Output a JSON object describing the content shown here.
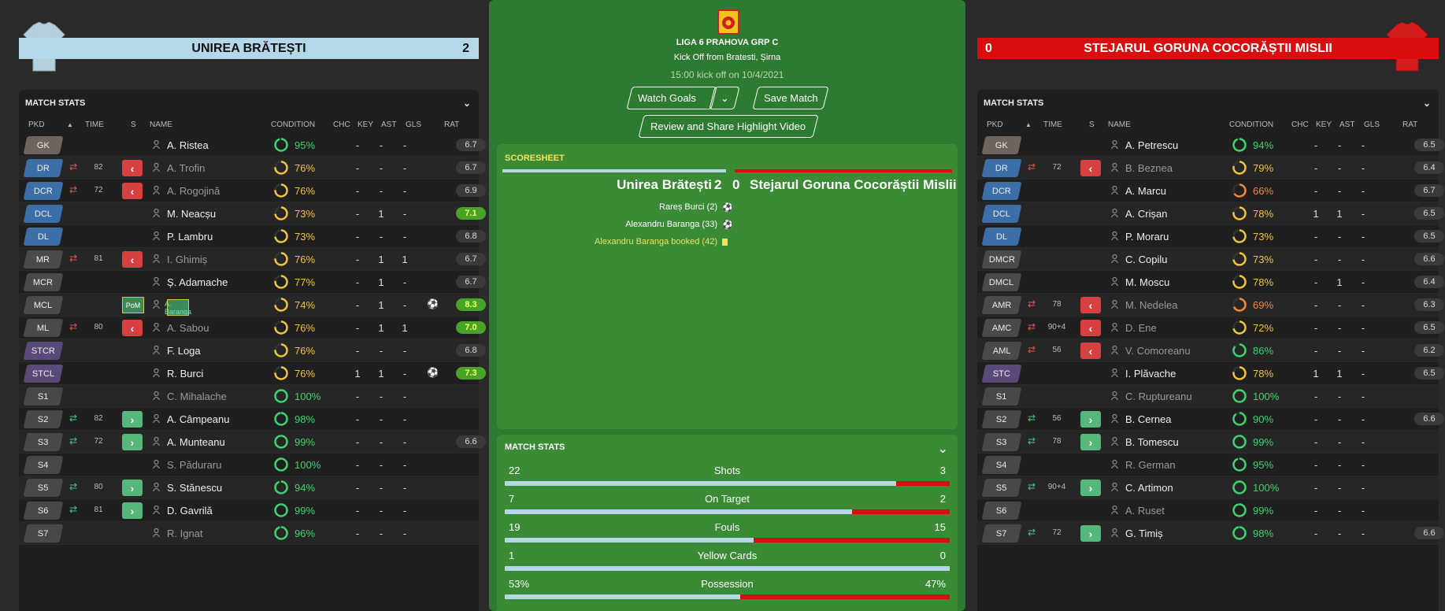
{
  "home": {
    "name": "UNIREA BRĂTEȘTI",
    "score": "2",
    "shirt_color": "#b5d0dc",
    "bar_color": "#b5d8e8"
  },
  "away": {
    "name": "STEJARUL GORUNA COCORĂȘTII MISLII",
    "score": "0",
    "shirt_color": "#d61d1d",
    "bar_color": "#d90f0f"
  },
  "center": {
    "league": "LIGA 6 PRAHOVA GRP C",
    "venue": "Kick Off from Bratesti, Șirna",
    "kickoff": "15:00 kick off on 10/4/2021",
    "watch_goals": "Watch Goals",
    "save_match": "Save Match",
    "review": "Review and Share Highlight Video",
    "scoresheet_title": "SCORESHEET",
    "sheet_home": "Unirea Brătești",
    "sheet_home_score": "2",
    "sheet_away_score": "0",
    "sheet_away": "Stejarul Goruna Cocorăștii Mislii",
    "events": [
      {
        "text": "Rareș Burci (2)",
        "icon": "ball-icon",
        "color": "#ffffff"
      },
      {
        "text": "Alexandru Baranga (33)",
        "icon": "ball-icon",
        "color": "#ffffff"
      },
      {
        "text": "Alexandru Baranga booked (42)",
        "icon": "yellow-card-icon",
        "color": "#f3e35a"
      }
    ],
    "match_stats_title": "MATCH STATS",
    "stats": [
      {
        "label": "Shots",
        "home": "22",
        "away": "3",
        "home_share": 0.88
      },
      {
        "label": "On Target",
        "home": "7",
        "away": "2",
        "home_share": 0.78
      },
      {
        "label": "Fouls",
        "home": "19",
        "away": "15",
        "home_share": 0.56
      },
      {
        "label": "Yellow Cards",
        "home": "1",
        "away": "0",
        "home_share": 1.0
      },
      {
        "label": "Possession",
        "home": "53%",
        "away": "47%",
        "home_share": 0.53
      }
    ]
  },
  "table_headers": {
    "title": "MATCH STATS",
    "pkd": "PKD",
    "time": "TIME",
    "s": "S",
    "name": "NAME",
    "condition": "CONDITION",
    "chc": "CHC",
    "key": "KEY",
    "ast": "AST",
    "gls": "GLS",
    "rat": "RAT",
    "sort_icon": "sort-up-icon"
  },
  "colors": {
    "gk": "#6e665e",
    "def": "#3c6fa8",
    "mid": "#4a4a4a",
    "att": "#5a4a7a",
    "sub": "#484848",
    "cond_green": "#3dd470",
    "cond_yellow": "#f2c43a",
    "cond_orange": "#f08a3a"
  },
  "home_players": [
    {
      "pos": "GK",
      "cat": "gk",
      "name": "A. Ristea",
      "cond": "95%",
      "cond_val": 0.95,
      "ccol": "cond_green",
      "chc": "-",
      "key": "-",
      "ast": "-",
      "gls": "",
      "rat": "6.7",
      "rat_green": false,
      "dim": false
    },
    {
      "pos": "DR",
      "cat": "def",
      "sub": "off",
      "time": "82",
      "name": "A. Trofin",
      "cond": "76%",
      "cond_val": 0.76,
      "ccol": "cond_yellow",
      "chc": "-",
      "key": "-",
      "ast": "-",
      "gls": "",
      "rat": "6.7",
      "dim": true
    },
    {
      "pos": "DCR",
      "cat": "def",
      "sub": "off",
      "time": "72",
      "name": "A. Rogojină",
      "cond": "76%",
      "cond_val": 0.76,
      "ccol": "cond_yellow",
      "chc": "-",
      "key": "-",
      "ast": "-",
      "gls": "",
      "rat": "6.9",
      "dim": true
    },
    {
      "pos": "DCL",
      "cat": "def",
      "name": "M. Neacșu",
      "cond": "73%",
      "cond_val": 0.73,
      "ccol": "cond_yellow",
      "chc": "-",
      "key": "1",
      "ast": "-",
      "gls": "",
      "rat": "7.1",
      "rat_green": true
    },
    {
      "pos": "DL",
      "cat": "def",
      "name": "P. Lambru",
      "cond": "73%",
      "cond_val": 0.73,
      "ccol": "cond_yellow",
      "chc": "-",
      "key": "-",
      "ast": "-",
      "gls": "",
      "rat": "6.8"
    },
    {
      "pos": "MR",
      "cat": "mid",
      "sub": "off",
      "time": "81",
      "name": "I. Ghimiș",
      "cond": "76%",
      "cond_val": 0.76,
      "ccol": "cond_yellow",
      "chc": "-",
      "key": "1",
      "ast": "1",
      "gls": "",
      "rat": "6.7",
      "dim": true
    },
    {
      "pos": "MCR",
      "cat": "mid",
      "name": "Ș. Adamache",
      "cond": "77%",
      "cond_val": 0.77,
      "ccol": "cond_yellow",
      "chc": "-",
      "key": "1",
      "ast": "-",
      "gls": "",
      "rat": "6.7"
    },
    {
      "pos": "MCL",
      "cat": "mid",
      "pom": "PoM",
      "name": "A. Baranga",
      "cond": "74%",
      "cond_val": 0.74,
      "ccol": "cond_yellow",
      "chc": "-",
      "key": "1",
      "ast": "-",
      "gls": "ball",
      "rat": "8.3",
      "rat_green": true,
      "highlight": true
    },
    {
      "pos": "ML",
      "cat": "mid",
      "sub": "off",
      "time": "80",
      "name": "A. Sabou",
      "cond": "76%",
      "cond_val": 0.76,
      "ccol": "cond_yellow",
      "chc": "-",
      "key": "1",
      "ast": "1",
      "gls": "",
      "rat": "7.0",
      "rat_green": true,
      "dim": true
    },
    {
      "pos": "STCR",
      "cat": "att",
      "name": "F. Loga",
      "cond": "76%",
      "cond_val": 0.76,
      "ccol": "cond_yellow",
      "chc": "-",
      "key": "-",
      "ast": "-",
      "gls": "",
      "rat": "6.8"
    },
    {
      "pos": "STCL",
      "cat": "att",
      "name": "R. Burci",
      "cond": "76%",
      "cond_val": 0.76,
      "ccol": "cond_yellow",
      "chc": "1",
      "key": "1",
      "ast": "-",
      "gls": "ball",
      "rat": "7.3",
      "rat_green": true
    },
    {
      "pos": "S1",
      "cat": "sub",
      "name": "C. Mihalache",
      "cond": "100%",
      "cond_val": 1.0,
      "ccol": "cond_green",
      "chc": "-",
      "key": "-",
      "ast": "-",
      "gls": "",
      "rat": "",
      "dim": true
    },
    {
      "pos": "S2",
      "cat": "sub",
      "sub": "on",
      "time": "82",
      "name": "A. Câmpeanu",
      "cond": "98%",
      "cond_val": 0.98,
      "ccol": "cond_green",
      "chc": "-",
      "key": "-",
      "ast": "-",
      "gls": "",
      "rat": ""
    },
    {
      "pos": "S3",
      "cat": "sub",
      "sub": "on",
      "time": "72",
      "name": "A. Munteanu",
      "cond": "99%",
      "cond_val": 0.99,
      "ccol": "cond_green",
      "chc": "-",
      "key": "-",
      "ast": "-",
      "gls": "",
      "rat": "6.6"
    },
    {
      "pos": "S4",
      "cat": "sub",
      "name": "S. Păduraru",
      "cond": "100%",
      "cond_val": 1.0,
      "ccol": "cond_green",
      "chc": "-",
      "key": "-",
      "ast": "-",
      "gls": "",
      "rat": "",
      "dim": true
    },
    {
      "pos": "S5",
      "cat": "sub",
      "sub": "on",
      "time": "80",
      "name": "S. Stănescu",
      "cond": "94%",
      "cond_val": 0.94,
      "ccol": "cond_green",
      "chc": "-",
      "key": "-",
      "ast": "-",
      "gls": "",
      "rat": ""
    },
    {
      "pos": "S6",
      "cat": "sub",
      "sub": "on",
      "time": "81",
      "name": "D. Gavrilă",
      "cond": "99%",
      "cond_val": 0.99,
      "ccol": "cond_green",
      "chc": "-",
      "key": "-",
      "ast": "-",
      "gls": "",
      "rat": ""
    },
    {
      "pos": "S7",
      "cat": "sub",
      "name": "R. Ignat",
      "cond": "96%",
      "cond_val": 0.96,
      "ccol": "cond_green",
      "chc": "-",
      "key": "-",
      "ast": "-",
      "gls": "",
      "rat": "",
      "dim": true
    }
  ],
  "away_players": [
    {
      "pos": "GK",
      "cat": "gk",
      "name": "A. Petrescu",
      "cond": "94%",
      "cond_val": 0.94,
      "ccol": "cond_green",
      "chc": "-",
      "key": "-",
      "ast": "-",
      "gls": "",
      "rat": "6.5"
    },
    {
      "pos": "DR",
      "cat": "def",
      "sub": "off",
      "time": "72",
      "name": "B. Beznea",
      "cond": "79%",
      "cond_val": 0.79,
      "ccol": "cond_yellow",
      "chc": "-",
      "key": "-",
      "ast": "-",
      "gls": "",
      "rat": "6.4",
      "dim": true
    },
    {
      "pos": "DCR",
      "cat": "def",
      "name": "A. Marcu",
      "cond": "66%",
      "cond_val": 0.66,
      "ccol": "cond_orange",
      "chc": "-",
      "key": "-",
      "ast": "-",
      "gls": "",
      "rat": "6.7"
    },
    {
      "pos": "DCL",
      "cat": "def",
      "name": "A. Crișan",
      "cond": "78%",
      "cond_val": 0.78,
      "ccol": "cond_yellow",
      "chc": "1",
      "key": "1",
      "ast": "-",
      "gls": "",
      "rat": "6.5"
    },
    {
      "pos": "DL",
      "cat": "def",
      "name": "P. Moraru",
      "cond": "73%",
      "cond_val": 0.73,
      "ccol": "cond_yellow",
      "chc": "-",
      "key": "-",
      "ast": "-",
      "gls": "",
      "rat": "6.5"
    },
    {
      "pos": "DMCR",
      "cat": "mid",
      "name": "C. Copilu",
      "cond": "73%",
      "cond_val": 0.73,
      "ccol": "cond_yellow",
      "chc": "-",
      "key": "-",
      "ast": "-",
      "gls": "",
      "rat": "6.6"
    },
    {
      "pos": "DMCL",
      "cat": "mid",
      "name": "M. Moscu",
      "cond": "78%",
      "cond_val": 0.78,
      "ccol": "cond_yellow",
      "chc": "-",
      "key": "1",
      "ast": "-",
      "gls": "",
      "rat": "6.4"
    },
    {
      "pos": "AMR",
      "cat": "mid",
      "sub": "off",
      "time": "78",
      "name": "M. Nedelea",
      "cond": "69%",
      "cond_val": 0.69,
      "ccol": "cond_orange",
      "chc": "-",
      "key": "-",
      "ast": "-",
      "gls": "",
      "rat": "6.3",
      "dim": true
    },
    {
      "pos": "AMC",
      "cat": "mid",
      "sub": "off",
      "time": "90+4",
      "name": "D. Ene",
      "cond": "72%",
      "cond_val": 0.72,
      "ccol": "cond_yellow",
      "chc": "-",
      "key": "-",
      "ast": "-",
      "gls": "",
      "rat": "6.5",
      "dim": true
    },
    {
      "pos": "AML",
      "cat": "mid",
      "sub": "off",
      "time": "56",
      "name": "V. Comoreanu",
      "cond": "86%",
      "cond_val": 0.86,
      "ccol": "cond_green",
      "chc": "-",
      "key": "-",
      "ast": "-",
      "gls": "",
      "rat": "6.2",
      "dim": true
    },
    {
      "pos": "STC",
      "cat": "att",
      "name": "I. Plăvache",
      "cond": "78%",
      "cond_val": 0.78,
      "ccol": "cond_yellow",
      "chc": "1",
      "key": "1",
      "ast": "-",
      "gls": "",
      "rat": "6.5"
    },
    {
      "pos": "S1",
      "cat": "sub",
      "name": "C. Ruptureanu",
      "cond": "100%",
      "cond_val": 1.0,
      "ccol": "cond_green",
      "chc": "-",
      "key": "-",
      "ast": "-",
      "gls": "",
      "rat": "",
      "dim": true
    },
    {
      "pos": "S2",
      "cat": "sub",
      "sub": "on",
      "time": "56",
      "name": "B. Cernea",
      "cond": "90%",
      "cond_val": 0.9,
      "ccol": "cond_green",
      "chc": "-",
      "key": "-",
      "ast": "-",
      "gls": "",
      "rat": "6.6"
    },
    {
      "pos": "S3",
      "cat": "sub",
      "sub": "on",
      "time": "78",
      "name": "B. Tomescu",
      "cond": "99%",
      "cond_val": 0.99,
      "ccol": "cond_green",
      "chc": "-",
      "key": "-",
      "ast": "-",
      "gls": "",
      "rat": ""
    },
    {
      "pos": "S4",
      "cat": "sub",
      "name": "R. German",
      "cond": "95%",
      "cond_val": 0.95,
      "ccol": "cond_green",
      "chc": "-",
      "key": "-",
      "ast": "-",
      "gls": "",
      "rat": "",
      "dim": true
    },
    {
      "pos": "S5",
      "cat": "sub",
      "sub": "on",
      "time": "90+4",
      "name": "C. Artimon",
      "cond": "100%",
      "cond_val": 1.0,
      "ccol": "cond_green",
      "chc": "-",
      "key": "-",
      "ast": "-",
      "gls": "",
      "rat": ""
    },
    {
      "pos": "S6",
      "cat": "sub",
      "name": "A. Ruset",
      "cond": "99%",
      "cond_val": 0.99,
      "ccol": "cond_green",
      "chc": "-",
      "key": "-",
      "ast": "-",
      "gls": "",
      "rat": "",
      "dim": true
    },
    {
      "pos": "S7",
      "cat": "sub",
      "sub": "on",
      "time": "72",
      "name": "G. Timiș",
      "cond": "98%",
      "cond_val": 0.98,
      "ccol": "cond_green",
      "chc": "-",
      "key": "-",
      "ast": "-",
      "gls": "",
      "rat": "6.6"
    }
  ]
}
